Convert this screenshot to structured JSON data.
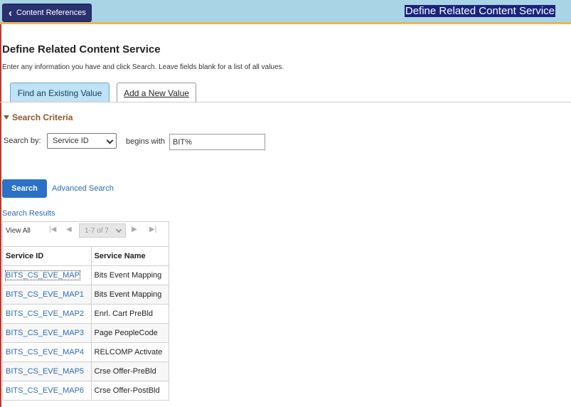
{
  "banner": {
    "back_button_label": "Content References",
    "page_heading": "Define Related Content Service"
  },
  "page": {
    "title": "Define Related Content Service",
    "instructions": "Enter any information you have and click Search. Leave fields blank for a list of all values."
  },
  "tabs": [
    {
      "label": "Find an Existing Value",
      "active": true
    },
    {
      "label": "Add a New Value",
      "active": false
    }
  ],
  "search_criteria": {
    "section_label": "Search Criteria",
    "search_by_label": "Search by:",
    "field_value": "Service ID",
    "operator_label": "begins with",
    "input_value": "BIT%"
  },
  "actions": {
    "search_button": "Search",
    "advanced_search_link": "Advanced Search"
  },
  "results": {
    "label": "Search Results",
    "view_all": "View All",
    "pager": "1-7 of 7",
    "columns": [
      "Service ID",
      "Service Name"
    ],
    "rows": [
      {
        "id": "BITS_CS_EVE_MAP",
        "name": "Bits Event Mapping"
      },
      {
        "id": "BITS_CS_EVE_MAP1",
        "name": "Bits Event Mapping"
      },
      {
        "id": "BITS_CS_EVE_MAP2",
        "name": "Enrl. Cart PreBld"
      },
      {
        "id": "BITS_CS_EVE_MAP3",
        "name": "Page PeopleCode"
      },
      {
        "id": "BITS_CS_EVE_MAP4",
        "name": "RELCOMP Activate"
      },
      {
        "id": "BITS_CS_EVE_MAP5",
        "name": "Crse Offer-PreBld"
      },
      {
        "id": "BITS_CS_EVE_MAP6",
        "name": "Crse Offer-PostBld"
      }
    ]
  },
  "colors": {
    "banner": "#a9d4e6",
    "accent_line": "#e8b55a",
    "back_button": "#2a3170",
    "primary_button": "#2b72c7",
    "link": "#2b6bb4",
    "section_heading": "#8a5a2b",
    "active_tab": "#bde3f5"
  },
  "icons": {
    "back": "chevron-left-icon",
    "collapse": "triangle-down-icon",
    "dropdown": "chevron-down-icon",
    "first": "first-page-icon",
    "prev": "previous-page-icon",
    "next": "next-page-icon",
    "last": "last-page-icon"
  }
}
